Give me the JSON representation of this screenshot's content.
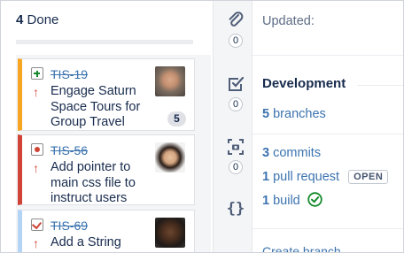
{
  "column": {
    "count": "4",
    "title": "Done"
  },
  "cards": [
    {
      "key": "TIS-19",
      "type": "story",
      "type_icon": "story-icon",
      "priority_icon": "priority-up-arrow-icon",
      "summary": "Engage Saturn Space Tours for Group Travel",
      "badge": "5",
      "accent_color": "#f6a623"
    },
    {
      "key": "TIS-56",
      "type": "bug",
      "type_icon": "bug-icon",
      "priority_icon": "priority-up-arrow-icon",
      "summary": "Add pointer to main css file to instruct users",
      "accent_color": "#d04437"
    },
    {
      "key": "TIS-69",
      "type": "task",
      "type_icon": "task-icon",
      "priority_icon": "priority-up-arrow-icon",
      "summary": "Add a String",
      "accent_color": "#b3d4f5"
    }
  ],
  "rail": {
    "attachments_count": "0",
    "subtasks_count": "0",
    "screenshots_count": "0",
    "code_glyph": "{}"
  },
  "detail": {
    "updated_label": "Updated:",
    "development_title": "Development",
    "branches_count": "5",
    "branches_label": "branches",
    "commits_count": "3",
    "commits_label": "commits",
    "pull_request_count": "1",
    "pull_request_label": "pull request",
    "pull_request_status": "OPEN",
    "build_count": "1",
    "build_label": "build",
    "more_text": "Create branch"
  },
  "colors": {
    "link": "#3b73af",
    "success": "#14892c",
    "priority": "#d04437"
  }
}
